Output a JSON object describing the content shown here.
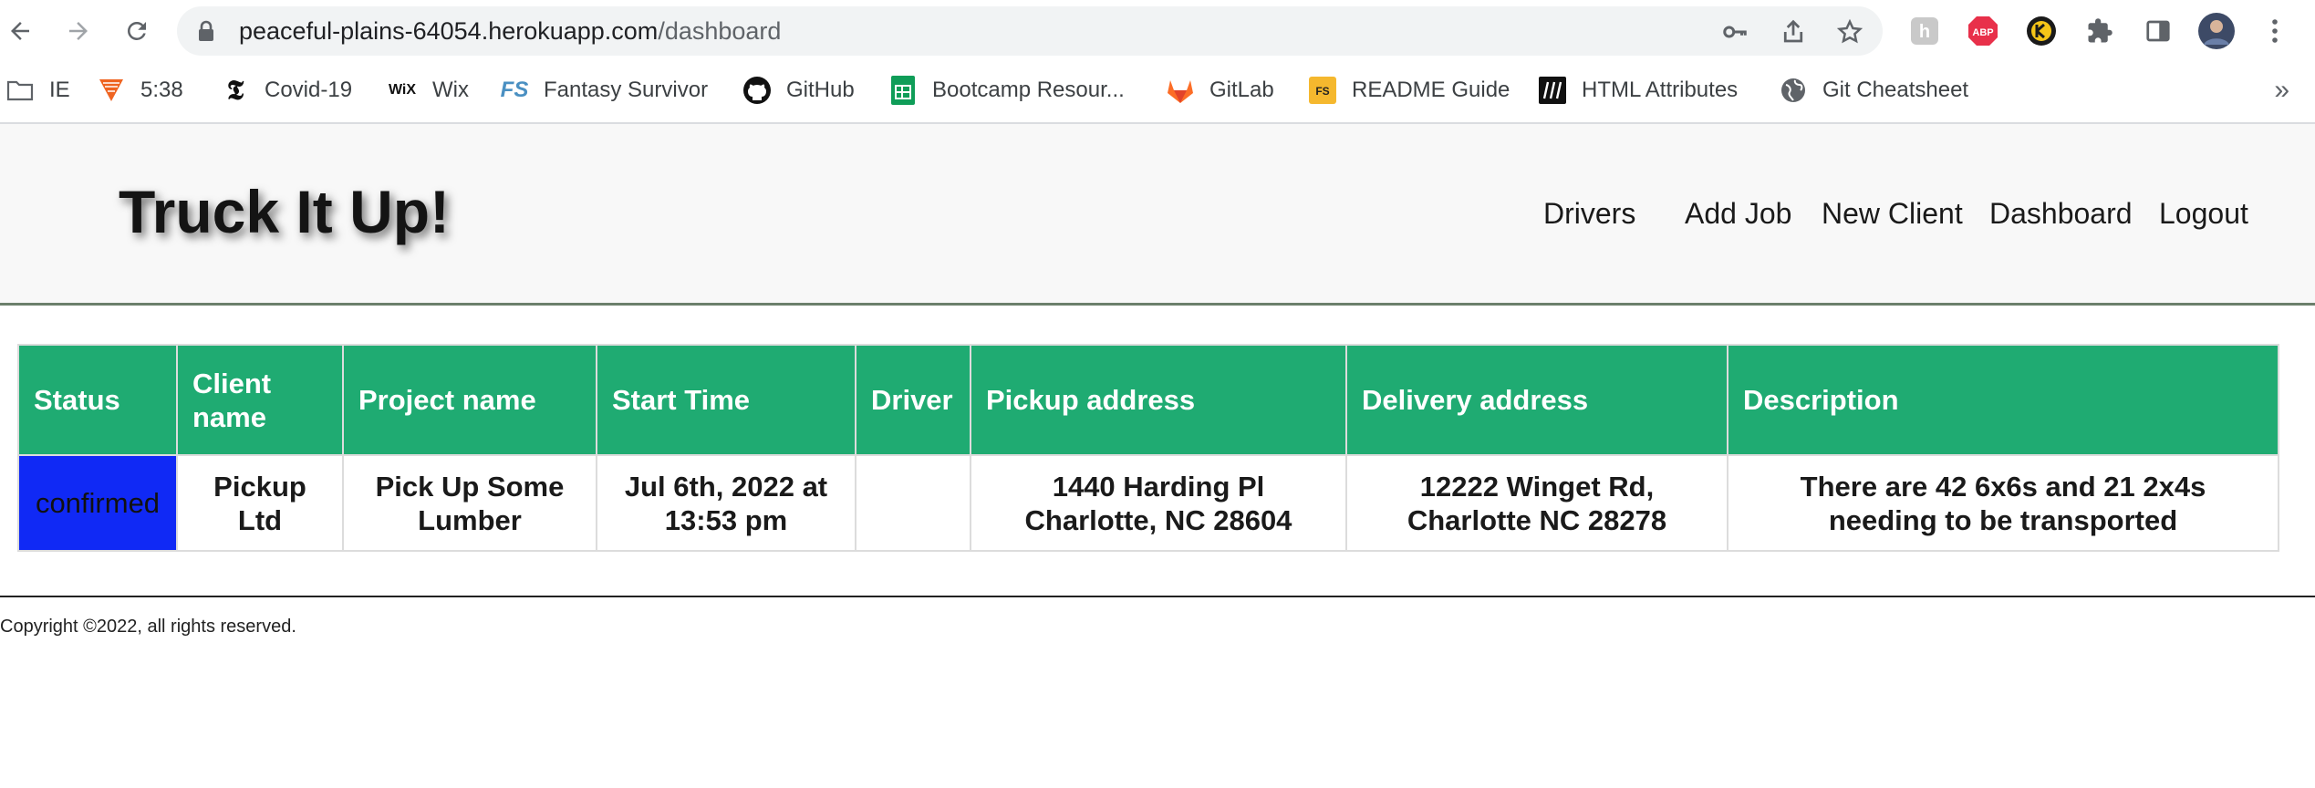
{
  "browser": {
    "url_host": "peaceful-plains-64054.herokuapp.com",
    "url_path": "/dashboard",
    "bookmarks": [
      {
        "label": "IE",
        "icon": "folder-icon"
      },
      {
        "label": "5:38",
        "icon": "fivethirtyeight-icon"
      },
      {
        "label": "Covid-19",
        "icon": "nyt-icon"
      },
      {
        "label": "Wix",
        "icon": "wix-icon"
      },
      {
        "label": "Fantasy Survivor",
        "icon": "fantasy-survivor-icon"
      },
      {
        "label": "GitHub",
        "icon": "github-icon"
      },
      {
        "label": "Bootcamp Resour...",
        "icon": "google-sheets-icon"
      },
      {
        "label": "GitLab",
        "icon": "gitlab-icon"
      },
      {
        "label": "README Guide",
        "icon": "readme-icon"
      },
      {
        "label": "HTML Attributes",
        "icon": "html-attributes-icon"
      },
      {
        "label": "Git Cheatsheet",
        "icon": "globe-icon"
      }
    ],
    "more_label": "»",
    "wix_glyph": "WiX",
    "fs_glyph": "FS"
  },
  "site": {
    "brand": "Truck It Up!",
    "nav": [
      "Drivers",
      "Add Job",
      "New Client",
      "Dashboard",
      "Logout"
    ]
  },
  "table": {
    "headers": [
      "Status",
      "Client name",
      "Project name",
      "Start Time",
      "Driver",
      "Pickup address",
      "Delivery address",
      "Description"
    ],
    "rows": [
      [
        "confirmed",
        "Pickup Ltd",
        "Pick Up Some Lumber",
        "Jul 6th, 2022 at 13:53 pm",
        "",
        "1440 Harding Pl Charlotte, NC 28604",
        "12222 Winget Rd, Charlotte NC 28278",
        "There are 42 6x6s and 21 2x4s needing to be transported"
      ]
    ],
    "status_color": "#1029f5",
    "header_color": "#1fab72"
  },
  "footer": {
    "copyright": "Copyright ©2022, all rights reserved."
  }
}
